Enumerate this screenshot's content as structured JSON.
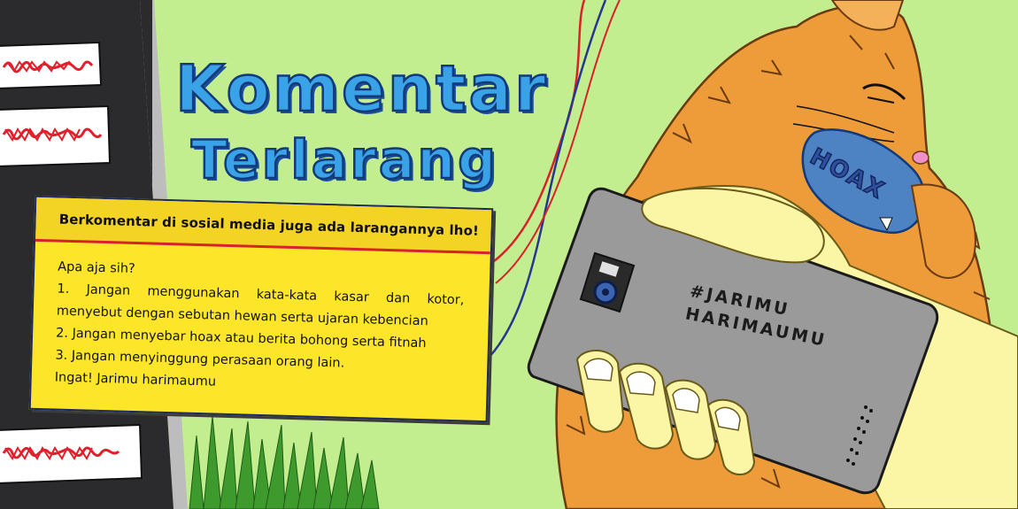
{
  "title": {
    "line1": "Komentar",
    "line2": "Terlarang"
  },
  "notice": {
    "heading": "Berkomentar di sosial media juga ada larangannya lho!",
    "intro": "Apa aja sih?",
    "rule1_line1": "1. Jangan menggunakan kata-kata kasar dan kotor,",
    "rule1_line2": "menyebut dengan sebutan hewan serta ujaran kebencian",
    "rule2": "2. Jangan menyebar hoax atau berita bohong serta fitnah",
    "rule3": "3. Jangan menyinggung perasaan orang lain.",
    "closing": "Ingat! Jarimu harimaumu"
  },
  "phone": {
    "hashtag_line1": "#JARIMU",
    "hashtag_line2": "HARIMAUMU"
  },
  "tiger": {
    "mouth_label": "HOAX"
  },
  "colors": {
    "background": "#c3ee8f",
    "title_fill": "#3aa2e6",
    "title_outline": "#123a7a",
    "notice_yellow": "#fde62a",
    "notice_rule_red": "#d8222b",
    "tiger_orange": "#ee9b3a",
    "phone_gray": "#9a9a9a",
    "scribble_red": "#e21f2b"
  }
}
